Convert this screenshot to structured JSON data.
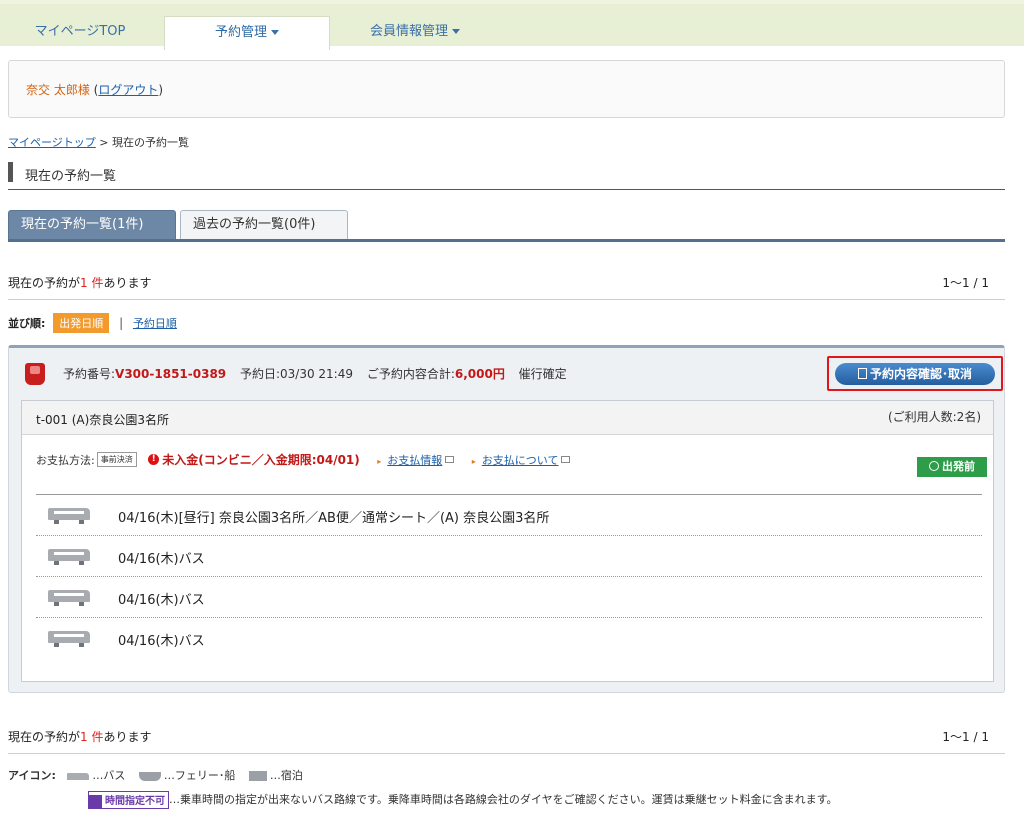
{
  "nav": {
    "items": [
      {
        "label": "マイページTOP"
      },
      {
        "label": "予約管理"
      },
      {
        "label": "会員情報管理"
      }
    ]
  },
  "user": {
    "name": "奈交 太郎様",
    "logout": "ログアウト",
    "paren_open": "(",
    "paren_close": ")"
  },
  "breadcrumb": {
    "home": "マイページトップ",
    "separator": " > ",
    "current": "現在の予約一覧"
  },
  "page_title": "現在の予約一覧",
  "tabs": [
    {
      "label": "現在の予約一覧(1件)"
    },
    {
      "label": "過去の予約一覧(0件)"
    }
  ],
  "count": {
    "prefix": "現在の予約が",
    "number": "1 件",
    "suffix": "あります",
    "range": "1～1 / 1"
  },
  "sort": {
    "label": "並び順:",
    "active": "出発日順",
    "separator": "|",
    "alt": "予約日順"
  },
  "reservation": {
    "number_label": "予約番号:",
    "number": "V300-1851-0389",
    "date": "予約日:03/30 21:49",
    "total_label": "ご予約内容合計:",
    "total": "6,000円",
    "status": "催行確定",
    "confirm_button": "予約内容確認･取消",
    "route_name": "t-001 (A)奈良公園3名所",
    "passengers": "(ご利用人数:2名)",
    "payment_label": "お支払方法:",
    "payment_type": "事前決済",
    "unpaid": "未入金(コンビニ／入金期限:04/01)",
    "link_payment_info": "お支払情報",
    "link_about_payment": "お支払について",
    "depart_badge": "出発前",
    "legs": [
      {
        "label": "04/16(木)[昼行] 奈良公園3名所／AB便／通常シート／(A) 奈良公園3名所"
      },
      {
        "label": "04/16(木)バス"
      },
      {
        "label": "04/16(木)バス"
      },
      {
        "label": "04/16(木)バス"
      }
    ]
  },
  "legend": {
    "label": "アイコン:",
    "bus": "…バス",
    "ferry": "…フェリー･船",
    "hotel": "…宿泊",
    "badge": "時間指定不可",
    "note": "…乗車時間の指定が出来ないバス路線です。乗降車時間は各路線会社のダイヤをご確認ください。運賃は乗継セット料金に含まれます。"
  },
  "colors": {
    "nav_bg": "#e7f0d4",
    "link": "#1b5fa8",
    "red": "#c21818",
    "active_tab": "#6d88a6",
    "sort_active": "#f29a2c",
    "confirm_button": "#2f6fb3",
    "highlight_border": "#e0161b",
    "depart_badge": "#2e9d49"
  }
}
